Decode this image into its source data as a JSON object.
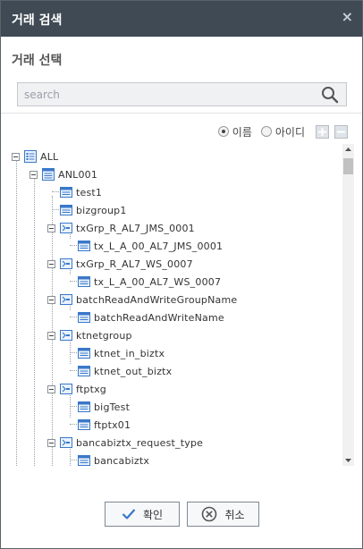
{
  "dialog": {
    "title": "거래 검색",
    "close_label": "×",
    "subtitle": "거래 선택"
  },
  "search": {
    "placeholder": "search",
    "value": ""
  },
  "options": {
    "name_label": "이름",
    "id_label": "아이디",
    "selected": "name"
  },
  "tree": {
    "root": "ALL",
    "nodes": [
      {
        "label": "ANL001",
        "type": "group"
      },
      {
        "label": "test1",
        "type": "tx"
      },
      {
        "label": "bizgroup1",
        "type": "tx"
      },
      {
        "label": "txGrp_R_AL7_JMS_0001",
        "type": "txgroup"
      },
      {
        "label": "tx_L_A_00_AL7_JMS_0001",
        "type": "tx"
      },
      {
        "label": "txGrp_R_AL7_WS_0007",
        "type": "txgroup"
      },
      {
        "label": "tx_L_A_00_AL7_WS_0007",
        "type": "tx"
      },
      {
        "label": "batchReadAndWriteGroupName",
        "type": "txgroup"
      },
      {
        "label": "batchReadAndWriteName",
        "type": "tx"
      },
      {
        "label": "ktnetgroup",
        "type": "txgroup"
      },
      {
        "label": "ktnet_in_biztx",
        "type": "tx"
      },
      {
        "label": "ktnet_out_biztx",
        "type": "tx"
      },
      {
        "label": "ftptxg",
        "type": "txgroup"
      },
      {
        "label": "bigTest",
        "type": "tx"
      },
      {
        "label": "ftptx01",
        "type": "tx"
      },
      {
        "label": "bancabiztx_request_type",
        "type": "txgroup"
      },
      {
        "label": "bancabiztx",
        "type": "tx"
      }
    ]
  },
  "buttons": {
    "ok_label": "확인",
    "cancel_label": "취소"
  },
  "colors": {
    "titlebar": "#3f4a54",
    "icon_blue": "#3a78c9",
    "border": "#7e8893"
  }
}
